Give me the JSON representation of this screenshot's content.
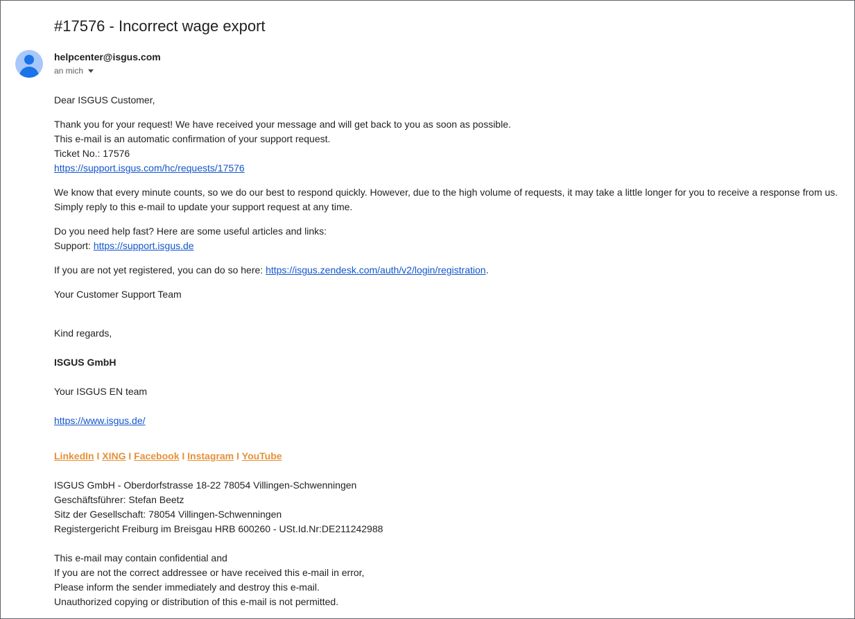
{
  "email": {
    "subject": "#17576 - Incorrect wage export",
    "sender": "helpcenter@isgus.com",
    "recipient": "an mich",
    "avatar_icon": "person-icon"
  },
  "body": {
    "greeting": "Dear ISGUS Customer,",
    "p1": {
      "line1": "Thank you for your request! We have received your message and will get back to you as soon as possible.",
      "line2": "This e-mail is an automatic confirmation of your support request.",
      "line3": "Ticket No.: 17576",
      "link": "https://support.isgus.com/hc/requests/17576"
    },
    "p2": {
      "line1": "We know that every minute counts, so we do our best to respond quickly. However, due to the high volume of requests, it may take a little longer for you to receive a response from us.",
      "line2": "Simply reply to this e-mail to update your support request at any time."
    },
    "p3": {
      "line1": "Do you need help fast? Here are some useful articles and links:",
      "support_label": "Support: ",
      "support_link": "https://support.isgus.de"
    },
    "p4": {
      "text": "If you are not yet registered, you can do so here: ",
      "link": "https://isgus.zendesk.com/auth/v2/login/registration",
      "suffix": "."
    },
    "team": "Your Customer Support Team",
    "regards": "Kind regards,",
    "company": "ISGUS GmbH",
    "team_en": "Your ISGUS EN team",
    "website": "https://www.isgus.de/",
    "social": {
      "linkedin": "LinkedIn",
      "xing": "XING",
      "facebook": "Facebook",
      "instagram": "Instagram",
      "youtube": "YouTube",
      "separator": "I"
    },
    "legal": {
      "line1": "ISGUS GmbH - Oberdorfstrasse 18-22 78054 Villingen-Schwenningen",
      "line2": "Geschäftsführer: Stefan Beetz",
      "line3": "Sitz der Gesellschaft: 78054 Villingen-Schwenningen",
      "line4": "Registergericht Freiburg im Breisgau HRB 600260 - USt.Id.Nr:DE211242988"
    },
    "disclaimer": {
      "line1": "This e-mail may contain confidential and",
      "line2": "If you are not the correct addressee or have received this e-mail in error,",
      "line3": "Please inform the sender immediately and destroy this e-mail.",
      "line4": "Unauthorized copying or distribution of this e-mail is not permitted."
    }
  }
}
